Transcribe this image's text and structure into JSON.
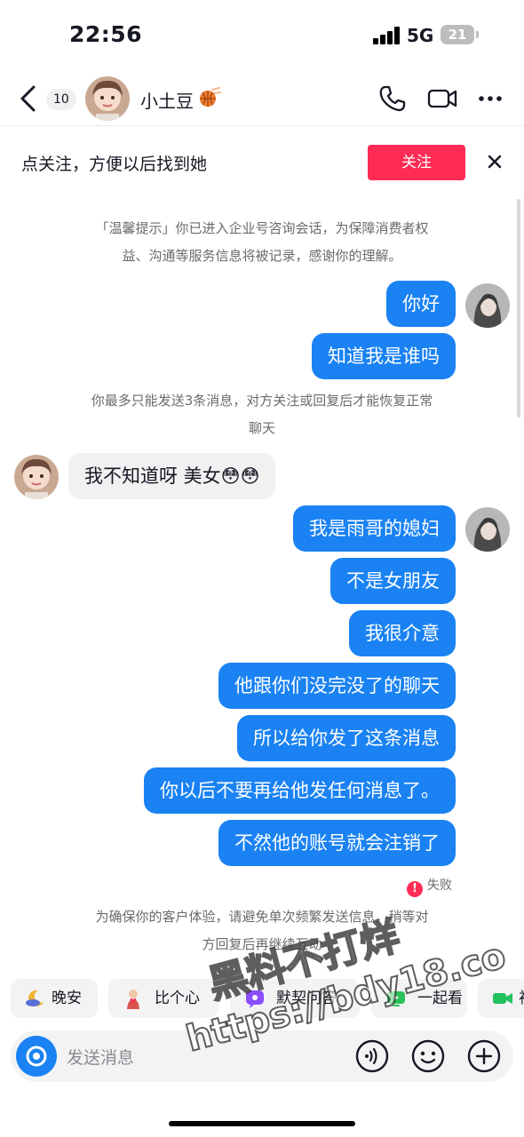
{
  "status_bar": {
    "time": "22:56",
    "network": "5G",
    "battery": "21"
  },
  "header": {
    "back_icon": "chevron-left-icon",
    "unread_count": "10",
    "contact_name": "小土豆",
    "name_emoji": "basketball-icon",
    "actions": [
      "phone-icon",
      "video-camera-icon",
      "more-icon"
    ]
  },
  "follow_banner": {
    "text": "点关注，方便以后找到她",
    "button_label": "关注",
    "accent_color": "#fe2c55"
  },
  "chat": {
    "notice_top": [
      "「温馨提示」你已进入企业号咨询会话，为保障消费者权",
      "益、沟通等服务信息将被记录，感谢你的理解。"
    ],
    "msg_1": "你好",
    "msg_2": "知道我是谁吗",
    "notice_limit": [
      "你最多只能发送3条消息，对方关注或回复后才能恢复正常",
      "聊天"
    ],
    "reply_1": "我不知道呀 美女😳😳",
    "msg_3": "我是雨哥的媳妇",
    "msg_4": "不是女朋友",
    "msg_5": "我很介意",
    "msg_6": "他跟你们没完没了的聊天",
    "msg_7": "所以给你发了这条消息",
    "msg_8": "你以后不要再给他发任何消息了。",
    "msg_9": "不然他的账号就会注销了",
    "fail_label": "失败",
    "notice_bottom": [
      "为确保你的客户体验，请避免单次频繁发送信息，稍等对",
      "方回复后再继续互动"
    ],
    "outgoing_color": "#1a82f3"
  },
  "quick_replies": [
    {
      "label": "晚安",
      "icon": "moon-icon"
    },
    {
      "label": "比个心",
      "icon": "heart-gesture-icon"
    },
    {
      "label": "默契问答",
      "icon": "quiz-icon"
    },
    {
      "label": "一起看",
      "icon": "watch-together-icon"
    },
    {
      "label": "视",
      "icon": "video-icon"
    }
  ],
  "composer": {
    "placeholder": "发送消息",
    "icons": [
      "camera-icon",
      "voice-icon",
      "emoji-icon",
      "plus-icon"
    ]
  },
  "watermark": {
    "line1": "黑料不打烊",
    "line2": "https://bdy18.co"
  }
}
